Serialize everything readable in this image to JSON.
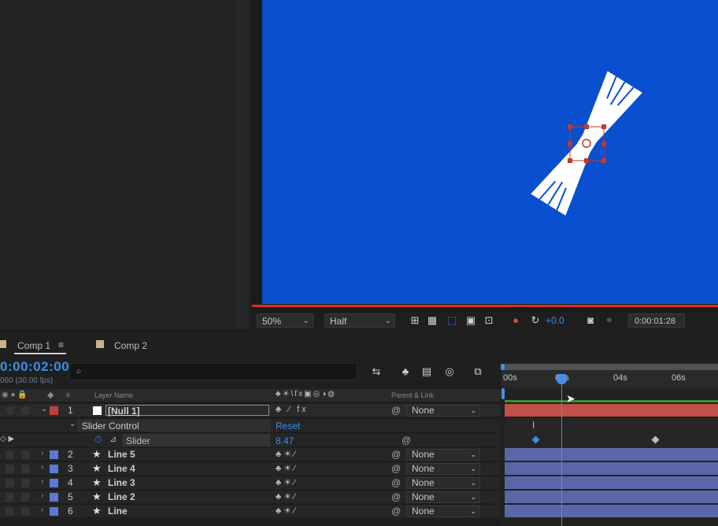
{
  "viewer": {
    "zoom": "50%",
    "resolution": "Half",
    "exposure": "+0.0",
    "current_time": "0:00:01:28"
  },
  "timeline": {
    "tabs": [
      {
        "label": "Comp 1",
        "active": true
      },
      {
        "label": "Comp 2",
        "active": false
      }
    ],
    "timecode": "0:00:02:00",
    "fps_text": "060 (30.00 fps)",
    "columns": {
      "layer_name": "Layer Name",
      "parent_link": "Parent & Link",
      "number": "#"
    },
    "ruler_labels": [
      "00s",
      "02s",
      "04s",
      "06s"
    ],
    "layers": [
      {
        "num": "1",
        "name": "[Null 1]",
        "color": "#c2403a",
        "parent": "None"
      },
      {
        "num": "2",
        "name": "Line 5",
        "color": "#5c78d6",
        "parent": "None"
      },
      {
        "num": "3",
        "name": "Line 4",
        "color": "#5c78d6",
        "parent": "None"
      },
      {
        "num": "4",
        "name": "Line 3",
        "color": "#5c78d6",
        "parent": "None"
      },
      {
        "num": "5",
        "name": "Line 2",
        "color": "#5c78d6",
        "parent": "None"
      },
      {
        "num": "6",
        "name": "Line",
        "color": "#5c78d6",
        "parent": "None"
      }
    ],
    "effect": {
      "name": "Slider Control",
      "reset_label": "Reset",
      "property": "Slider",
      "value": "8.47"
    }
  },
  "colors": {
    "accent_blue": "#3d8ee8",
    "comp_background": "#0a4fcf",
    "null_bar": "#c24f48",
    "shape_bar": "#5a66a8"
  }
}
